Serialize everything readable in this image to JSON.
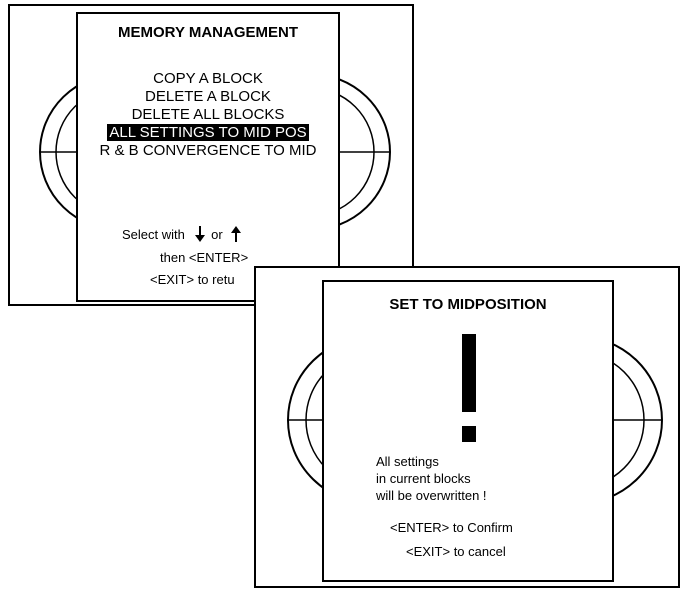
{
  "memory_management": {
    "title": "MEMORY MANAGEMENT",
    "items": [
      {
        "label": "COPY A BLOCK",
        "selected": false
      },
      {
        "label": "DELETE A BLOCK",
        "selected": false
      },
      {
        "label": "DELETE ALL BLOCKS",
        "selected": false
      },
      {
        "label": "ALL SETTINGS TO MID POS",
        "selected": true
      },
      {
        "label": "R & B CONVERGENCE TO MID",
        "selected": false
      }
    ],
    "hint_select": "Select with",
    "hint_or": "or",
    "hint_enter": "then <ENTER>",
    "hint_exit": "<EXIT> to retu"
  },
  "set_to_midposition": {
    "title": "SET TO MIDPOSITION",
    "warning_line_1": "All settings",
    "warning_line_2": "in current blocks",
    "warning_line_3": "will be overwritten !",
    "confirm_hint": "<ENTER> to Confirm",
    "cancel_hint": "<EXIT> to cancel"
  },
  "icons": {
    "down": "arrow-down-icon",
    "up": "arrow-up-icon",
    "warning": "exclamation-icon"
  },
  "colors": {
    "background": "#ffffff",
    "foreground": "#000000",
    "selection_bg": "#000000",
    "selection_fg": "#ffffff"
  }
}
